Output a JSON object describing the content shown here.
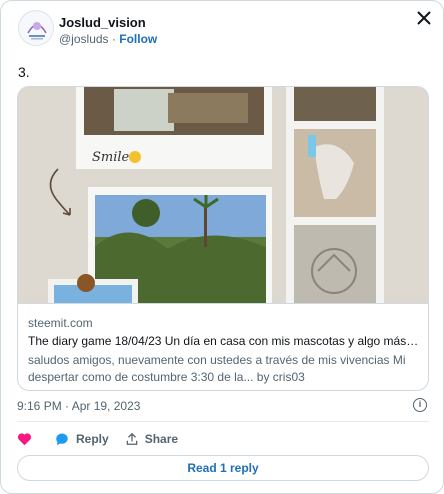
{
  "author": {
    "name": "Joslud_vision",
    "handle": "@josluds",
    "separator": "·",
    "follow_label": "Follow"
  },
  "tweet": {
    "text": "3."
  },
  "link_card": {
    "domain": "steemit.com",
    "title": "The diary game 18/04/23 Un día en casa con mis mascotas y algo más... ...",
    "description": "saludos amigos, nuevamente con ustedes a través de mis vivencias Mi despertar como de costumbre 3:30 de la... by cris03",
    "preview_caption": "Smile"
  },
  "timestamp": "9:16 PM · Apr 19, 2023",
  "info_icon": "i",
  "actions": {
    "like_icon": "heart-icon",
    "reply_label": "Reply",
    "share_label": "Share"
  },
  "read_replies_label": "Read 1 reply",
  "colors": {
    "accent": "#1d6fb8",
    "like": "#f91880",
    "reply_bubble": "#1d9bf0"
  }
}
